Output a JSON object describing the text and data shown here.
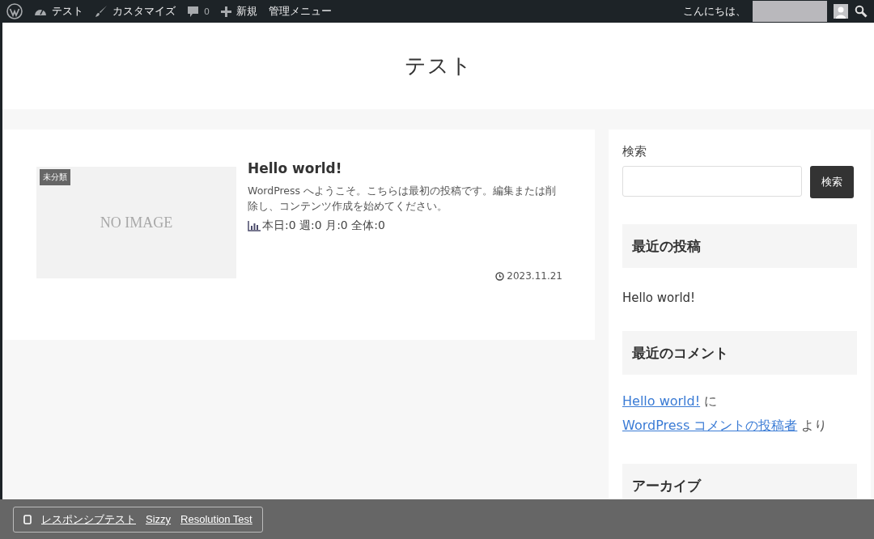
{
  "admin_bar": {
    "items": [
      {
        "kind": "logo"
      },
      {
        "kind": "site",
        "label": "テスト"
      },
      {
        "kind": "customize",
        "label": "カスタマイズ"
      },
      {
        "kind": "comments",
        "label": "0"
      },
      {
        "kind": "new",
        "label": "新規"
      },
      {
        "kind": "menu",
        "label": "管理メニュー"
      }
    ],
    "greeting": "こんにちは、"
  },
  "site_title": "テスト",
  "post": {
    "category": "未分類",
    "thumbnail_text": "NO IMAGE",
    "title": "Hello world!",
    "excerpt": "WordPress へようこそ。こちらは最初の投稿です。編集または削除し、コンテンツ作成を始めてください。",
    "stats": "本日:0 週:0 月:0 全体:0",
    "date": "2023.11.21"
  },
  "sidebar": {
    "search_label": "検索",
    "search_button": "検索",
    "widgets": [
      {
        "kind": "posts",
        "title": "最近の投稿",
        "items": [
          "Hello world!"
        ]
      },
      {
        "kind": "comments",
        "title": "最近のコメント",
        "comments": [
          {
            "post": "Hello world!",
            "connector": "に",
            "author": "WordPress コメントの投稿者",
            "suffix": "より"
          }
        ]
      },
      {
        "kind": "archive",
        "title": "アーカイブ"
      }
    ]
  },
  "toolbar": {
    "links": [
      "レスポンシブテスト",
      "Sizzy",
      "Resolution Test"
    ]
  }
}
